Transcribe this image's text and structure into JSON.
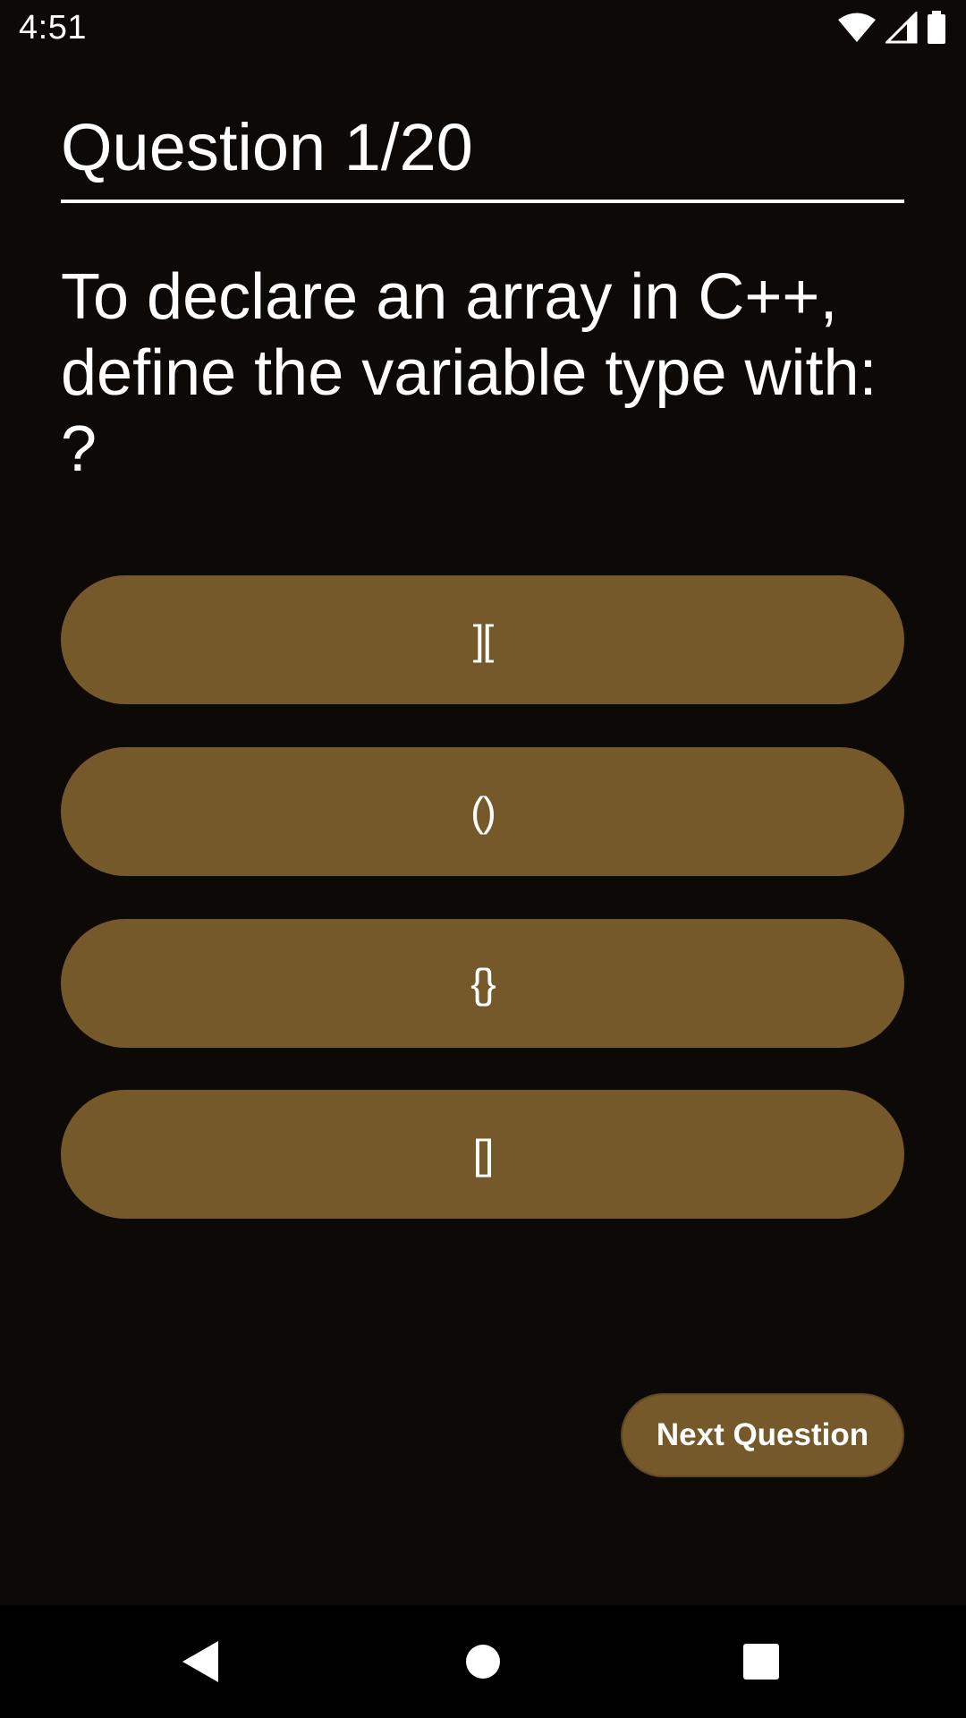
{
  "status_bar": {
    "time": "4:51",
    "icons": [
      "wifi-icon",
      "cell-signal-icon",
      "battery-icon"
    ]
  },
  "quiz": {
    "question_number": "Question 1/20",
    "question_text": "To declare an array in C++,\ndefine the variable type with:\n?",
    "options": [
      "][",
      "()",
      "{}",
      "[]"
    ],
    "next_label": "Next Question"
  },
  "colors": {
    "background": "#0c0906",
    "button": "#76592a",
    "text": "#ffffff"
  },
  "nav_bar": {
    "icons": [
      "back-icon",
      "home-icon",
      "recents-icon"
    ]
  }
}
